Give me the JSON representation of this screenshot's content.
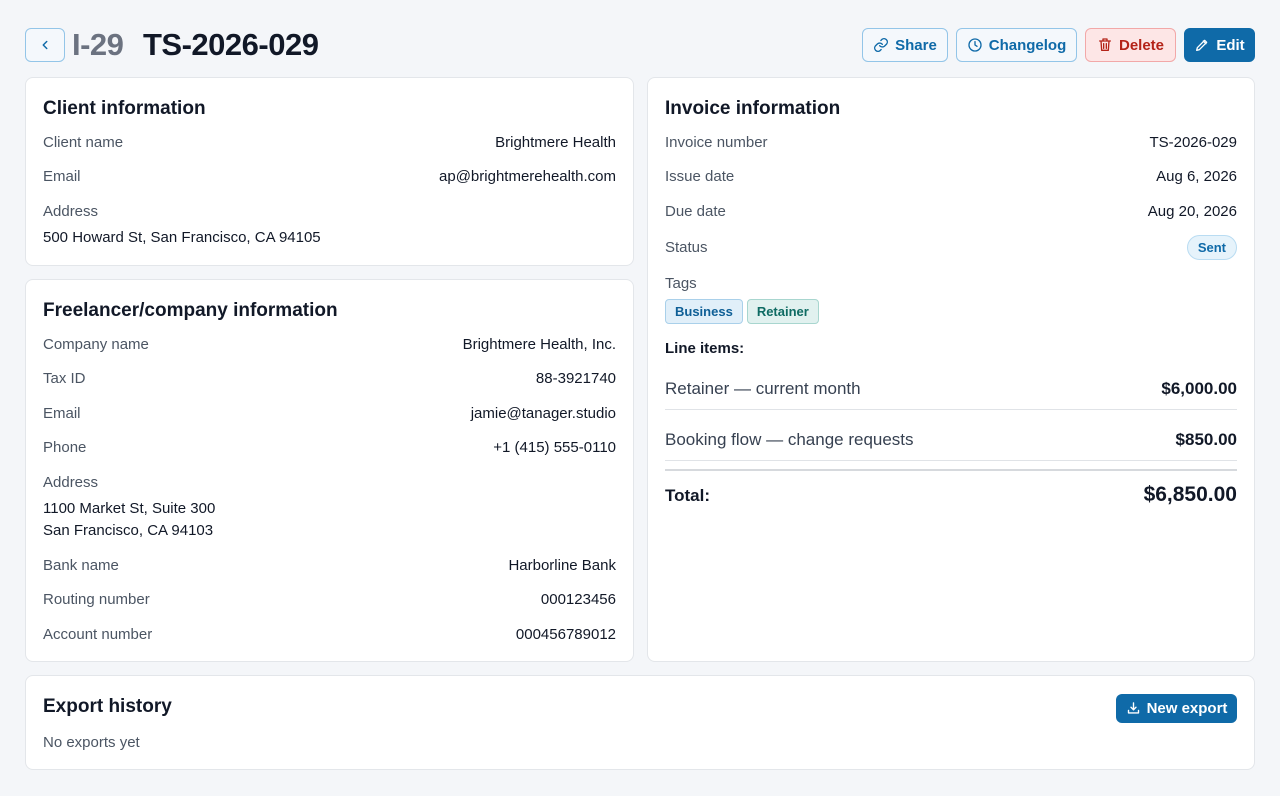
{
  "header": {
    "id_prefix": "I-29",
    "title": "TS-2026-029",
    "buttons": {
      "share": "Share",
      "changelog": "Changelog",
      "delete": "Delete",
      "edit": "Edit"
    }
  },
  "client": {
    "title": "Client information",
    "fields": {
      "name_label": "Client name",
      "name_value": "Brightmere Health",
      "email_label": "Email",
      "email_value": "ap@brightmerehealth.com",
      "address_label": "Address",
      "address_value": "500 Howard St, San Francisco, CA 94105"
    }
  },
  "freelancer": {
    "title": "Freelancer/company information",
    "fields": {
      "company_label": "Company name",
      "company_value": "Brightmere Health, Inc.",
      "tax_label": "Tax ID",
      "tax_value": "88-3921740",
      "email_label": "Email",
      "email_value": "jamie@tanager.studio",
      "phone_label": "Phone",
      "phone_value": "+1 (415) 555-0110",
      "address_label": "Address",
      "address_line1": "1100 Market St, Suite 300",
      "address_line2": "San Francisco, CA 94103",
      "bank_label": "Bank name",
      "bank_value": "Harborline Bank",
      "routing_label": "Routing number",
      "routing_value": "000123456",
      "account_label": "Account number",
      "account_value": "000456789012"
    }
  },
  "invoice": {
    "title": "Invoice information",
    "fields": {
      "number_label": "Invoice number",
      "number_value": "TS-2026-029",
      "issue_label": "Issue date",
      "issue_value": "Aug 6, 2026",
      "due_label": "Due date",
      "due_value": "Aug 20, 2026",
      "status_label": "Status",
      "status_value": "Sent",
      "tags_label": "Tags"
    },
    "tags": [
      "Business",
      "Retainer"
    ],
    "line_items_label": "Line items:",
    "line_items": [
      {
        "description": "Retainer — current month",
        "amount": "$6,000.00"
      },
      {
        "description": "Booking flow — change requests",
        "amount": "$850.00"
      }
    ],
    "total_label": "Total:",
    "total_value": "$6,850.00"
  },
  "export": {
    "title": "Export history",
    "new_button": "New export",
    "empty_text": "No exports yet"
  },
  "colors": {
    "accent": "#0f6aa8",
    "danger": "#b42318",
    "background": "#f4f6f9"
  }
}
